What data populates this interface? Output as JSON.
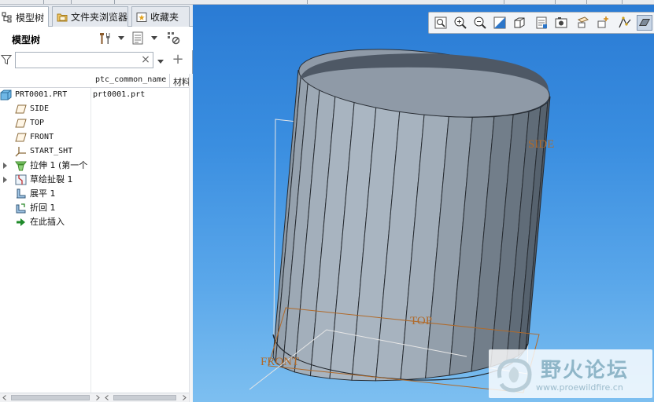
{
  "tabs": [
    {
      "label": "模型树",
      "icon": "model-tree-icon",
      "active": true
    },
    {
      "label": "文件夹浏览器",
      "icon": "folder-browser-icon",
      "active": false
    },
    {
      "label": "收藏夹",
      "icon": "favorites-icon",
      "active": false
    }
  ],
  "tree_panel": {
    "title": "模型树",
    "filter_placeholder": "",
    "clear_glyph": "×",
    "add_glyph": "+"
  },
  "columns": [
    "ptc_common_name",
    "材料"
  ],
  "tree_items": [
    {
      "label": "PRT0001.PRT",
      "value": "prt0001.prt",
      "icon": "part-icon",
      "expandable": false
    },
    {
      "label": "SIDE",
      "value": "",
      "icon": "datum-plane-icon",
      "expandable": false
    },
    {
      "label": "TOP",
      "value": "",
      "icon": "datum-plane-icon",
      "expandable": false
    },
    {
      "label": "FRONT",
      "value": "",
      "icon": "datum-plane-icon",
      "expandable": false
    },
    {
      "label": "START_SHT",
      "value": "",
      "icon": "coordinate-system-icon",
      "expandable": false
    },
    {
      "label": "拉伸 1 (第一个",
      "value": "",
      "icon": "extrude-icon",
      "expandable": true
    },
    {
      "label": "草绘扯裂 1",
      "value": "",
      "icon": "sketched-rip-icon",
      "expandable": true
    },
    {
      "label": "展平 1",
      "value": "",
      "icon": "unbend-icon",
      "expandable": false
    },
    {
      "label": "折回 1",
      "value": "",
      "icon": "bend-back-icon",
      "expandable": false
    },
    {
      "label": "在此插入",
      "value": "",
      "icon": "insert-here-arrow-icon",
      "expandable": false
    }
  ],
  "view_toolbar": [
    "refit-icon",
    "zoom-in-icon",
    "zoom-out-icon",
    "repaint-icon",
    "saved-orientations-icon",
    "view-manager-icon",
    "display-style-icon",
    "datum-display-icon",
    "spin-center-icon",
    "annotation-display-icon",
    "shading-icon"
  ],
  "datum_labels": {
    "side": "SIDE",
    "top": "TOP",
    "front": "FRONT"
  },
  "watermark": {
    "text": "野火论坛",
    "url": "www.proewildfire.cn"
  },
  "colors": {
    "background_top": "#2a7bd4",
    "background_bottom": "#7dbff0",
    "datum_label": "#b06a2a",
    "datum_outline": "#e6e6e6",
    "model_light": "#aab5c0",
    "model_dark": "#556270"
  }
}
